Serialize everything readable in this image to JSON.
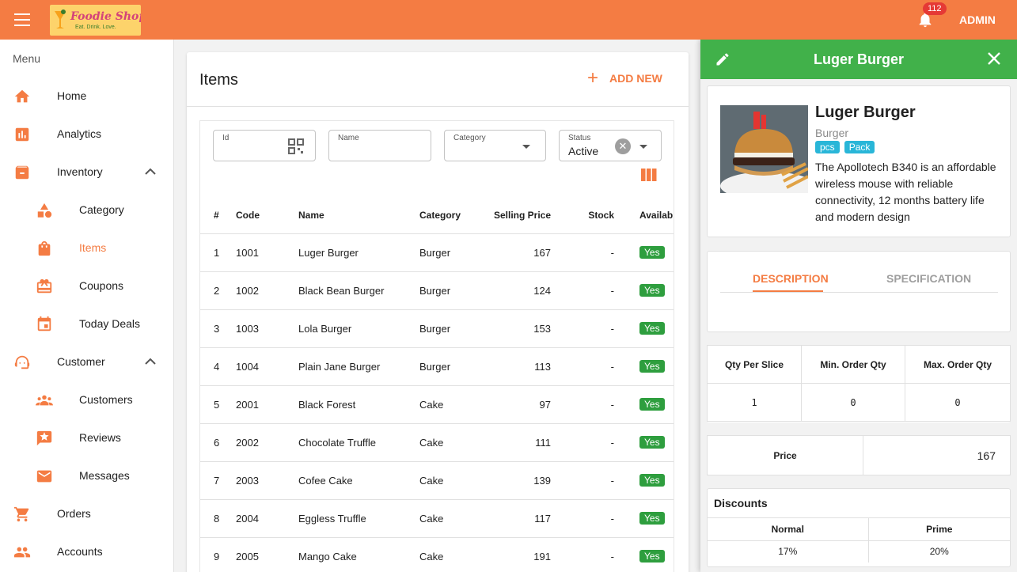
{
  "header": {
    "logo_text": "Foodie Shopie",
    "logo_tagline": "Eat. Drink. Love.",
    "notification_count": "112",
    "user_label": "ADMIN",
    "brand_color": "#f47c43"
  },
  "sidebar": {
    "menu_title": "Menu",
    "items": [
      {
        "label": "Home",
        "icon": "home-icon"
      },
      {
        "label": "Analytics",
        "icon": "analytics-icon"
      },
      {
        "label": "Inventory",
        "icon": "archive-icon"
      },
      {
        "label": "Category",
        "icon": "category-icon"
      },
      {
        "label": "Items",
        "icon": "shopping-bag-icon"
      },
      {
        "label": "Coupons",
        "icon": "coupon-icon"
      },
      {
        "label": "Today Deals",
        "icon": "calendar-icon"
      },
      {
        "label": "Customer",
        "icon": "support-agent-icon"
      },
      {
        "label": "Customers",
        "icon": "people-icon"
      },
      {
        "label": "Reviews",
        "icon": "review-icon"
      },
      {
        "label": "Messages",
        "icon": "mail-icon"
      },
      {
        "label": "Orders",
        "icon": "cart-icon"
      },
      {
        "label": "Accounts",
        "icon": "people-icon"
      }
    ],
    "active_item": "Items"
  },
  "items_page": {
    "title": "Items",
    "add_new_label": "ADD NEW",
    "filters": {
      "id_label": "Id",
      "name_label": "Name",
      "category_label": "Category",
      "status_label": "Status",
      "status_value": "Active"
    },
    "table": {
      "headers": [
        "#",
        "Code",
        "Name",
        "Category",
        "Selling Price",
        "Stock",
        "Available"
      ],
      "rows": [
        {
          "idx": "1",
          "code": "1001",
          "name": "Luger Burger",
          "category": "Burger",
          "price": "167",
          "stock": "-",
          "available": "Yes"
        },
        {
          "idx": "2",
          "code": "1002",
          "name": "Black Bean Burger",
          "category": "Burger",
          "price": "124",
          "stock": "-",
          "available": "Yes"
        },
        {
          "idx": "3",
          "code": "1003",
          "name": "Lola Burger",
          "category": "Burger",
          "price": "153",
          "stock": "-",
          "available": "Yes"
        },
        {
          "idx": "4",
          "code": "1004",
          "name": "Plain Jane Burger",
          "category": "Burger",
          "price": "113",
          "stock": "-",
          "available": "Yes"
        },
        {
          "idx": "5",
          "code": "2001",
          "name": "Black Forest",
          "category": "Cake",
          "price": "97",
          "stock": "-",
          "available": "Yes"
        },
        {
          "idx": "6",
          "code": "2002",
          "name": "Chocolate Truffle",
          "category": "Cake",
          "price": "111",
          "stock": "-",
          "available": "Yes"
        },
        {
          "idx": "7",
          "code": "2003",
          "name": "Cofee Cake",
          "category": "Cake",
          "price": "139",
          "stock": "-",
          "available": "Yes"
        },
        {
          "idx": "8",
          "code": "2004",
          "name": "Eggless Truffle",
          "category": "Cake",
          "price": "117",
          "stock": "-",
          "available": "Yes"
        },
        {
          "idx": "9",
          "code": "2005",
          "name": "Mango Cake",
          "category": "Cake",
          "price": "191",
          "stock": "-",
          "available": "Yes"
        }
      ]
    }
  },
  "drawer": {
    "header_title": "Luger Burger",
    "product": {
      "name": "Luger Burger",
      "category": "Burger",
      "units": [
        "pcs",
        "Pack"
      ],
      "description": "The Apollotech B340 is an affordable wireless mouse with reliable connectivity, 12 months battery life and modern design"
    },
    "tabs": [
      "DESCRIPTION",
      "SPECIFICATION"
    ],
    "active_tab": "DESCRIPTION",
    "qty": {
      "headers": [
        "Qty Per Slice",
        "Min. Order Qty",
        "Max. Order Qty"
      ],
      "values": [
        "1",
        "0",
        "0"
      ]
    },
    "price": {
      "label": "Price",
      "value": "167"
    },
    "discounts": {
      "title": "Discounts",
      "headers": [
        "Normal",
        "Prime"
      ],
      "values": [
        "17%",
        "20%"
      ]
    }
  }
}
